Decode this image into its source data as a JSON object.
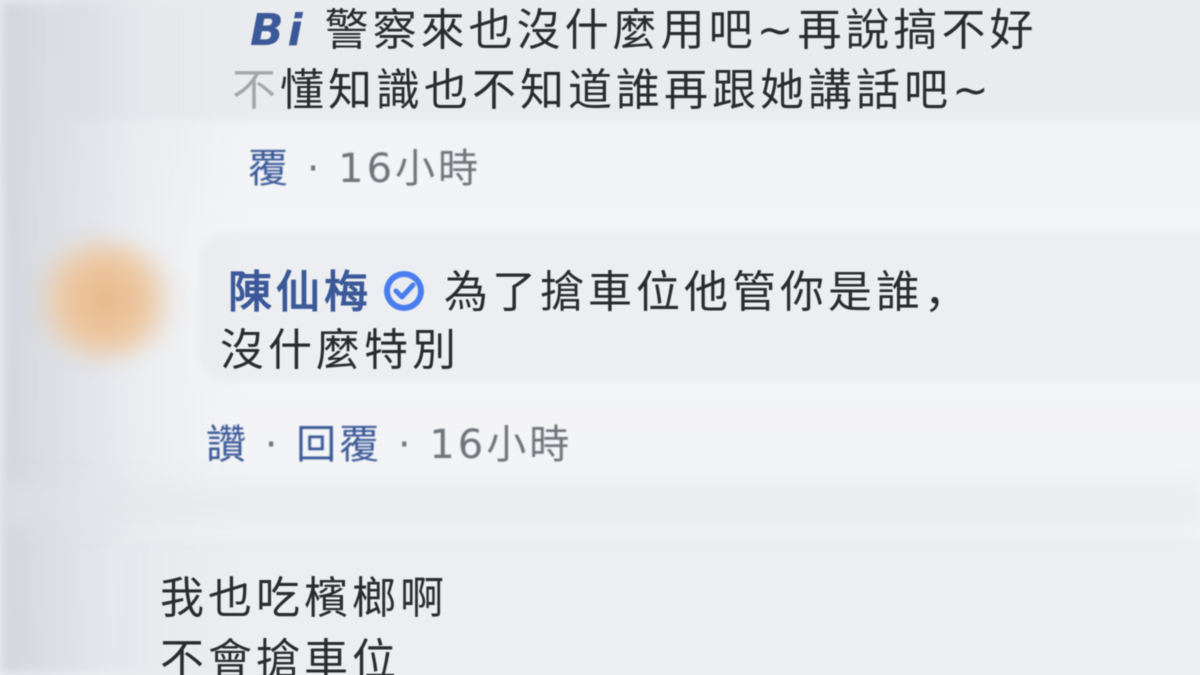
{
  "comment1": {
    "name_fragment": "Bi",
    "line1": "警察來也沒什麼用吧~再說搞不好",
    "line2": "懂知識也不知道誰再跟她講話吧~",
    "left_fragment": "不",
    "reply_fragment": "覆",
    "separator": "·",
    "time": "16小時"
  },
  "comment2": {
    "name": "陳仙梅",
    "verified_icon": "verified-badge-icon",
    "text_line1": "為了搶車位他管你是誰，",
    "text_line2": "沒什麼特別",
    "like_fragment": "讚",
    "separator1": "·",
    "reply": "回覆",
    "separator2": "·",
    "time": "16小時"
  },
  "comment3": {
    "line1_fragment": "我也吃檳榔啊",
    "line2_fragment": "不會搶車位"
  },
  "colors": {
    "link": "#3b5998",
    "badge": "#4a7ef0"
  }
}
